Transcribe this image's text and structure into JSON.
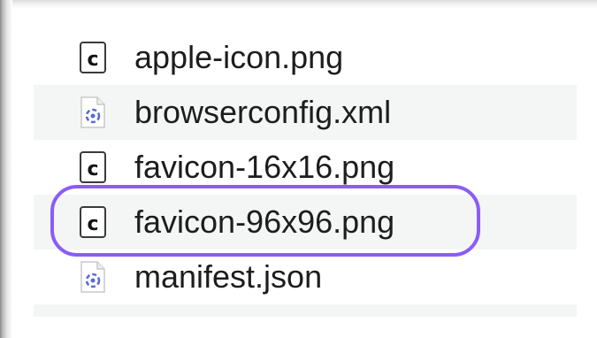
{
  "files": [
    {
      "name": "apple-icon.png",
      "icon": "png-c-icon"
    },
    {
      "name": "browserconfig.xml",
      "icon": "xml-file-icon"
    },
    {
      "name": "favicon-16x16.png",
      "icon": "png-c-icon"
    },
    {
      "name": "favicon-96x96.png",
      "icon": "png-c-icon",
      "highlighted": true
    },
    {
      "name": "manifest.json",
      "icon": "json-file-icon"
    }
  ],
  "colors": {
    "highlight_outline": "#8b5cf6",
    "alt_row": "#f4f5f5",
    "text": "#1d1d1f",
    "file_icon_glyph": "#5b6bd6"
  }
}
